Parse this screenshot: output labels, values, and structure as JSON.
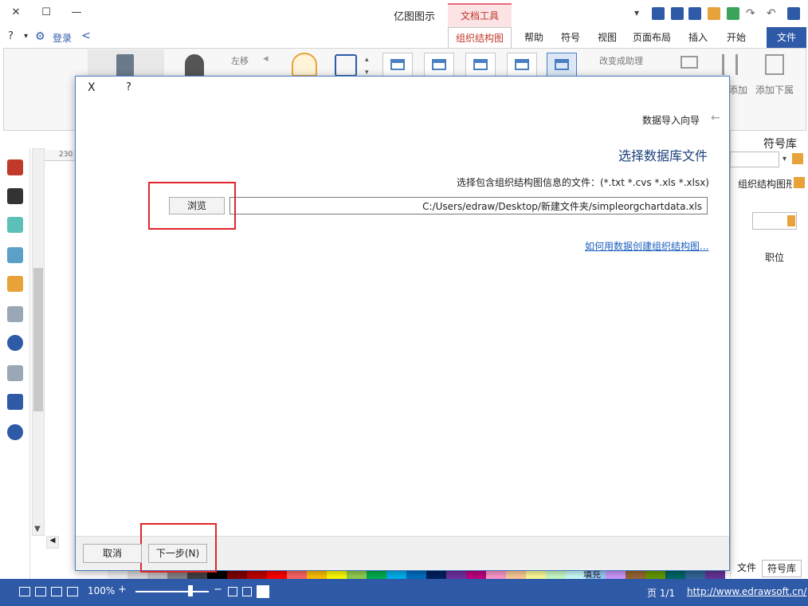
{
  "app": {
    "title": "亿图图示",
    "context_tab": "文档工具",
    "login": "登录"
  },
  "tabs": [
    {
      "label": "文件"
    },
    {
      "label": "开始"
    },
    {
      "label": "插入"
    },
    {
      "label": "页面布局"
    },
    {
      "label": "视图"
    },
    {
      "label": "符号"
    },
    {
      "label": "帮助"
    },
    {
      "label": "组织结构图"
    }
  ],
  "ribbon": {
    "left_move": "左移",
    "change_layout": "改变成助理",
    "add_sub": "添加下属",
    "add_colleague": "添加"
  },
  "ruler": {
    "mark": "230"
  },
  "dialog": {
    "wizard_title": "数据导入向导",
    "heading": "选择数据库文件",
    "instruction": "选择包含组织结构图信息的文件：(*.txt *.cvs *.xls *.xlsx)",
    "file_path": "C:/Users/edraw/Desktop/新建文件夹/simpleorgchartdata.xls",
    "browse": "浏览",
    "help_link": "如何用数据创建组织结构图...",
    "next": "下一步(N)",
    "cancel": "取消",
    "help_btn": "?",
    "close_btn": "X"
  },
  "right_panel": {
    "title": "符号库",
    "category": "组织结构图形状",
    "shape_label": "职位",
    "tab_symbols": "符号库",
    "tab_files": "文件"
  },
  "status": {
    "url": "http://www.edrawsoft.cn/",
    "page": "页 1/1",
    "zoom": "100%",
    "fill_label": "填充"
  },
  "colors": {
    "accent": "#2f5aa8",
    "context": "#e46a7a",
    "highlight": "#e0262b",
    "link": "#1a5fbf"
  }
}
